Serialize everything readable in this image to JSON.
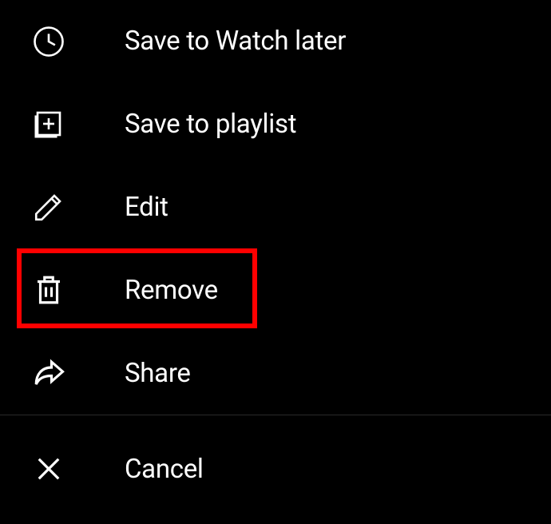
{
  "menu": {
    "items": [
      {
        "label": "Save to Watch later",
        "icon": "clock"
      },
      {
        "label": "Save to playlist",
        "icon": "playlist-add"
      },
      {
        "label": "Edit",
        "icon": "pencil"
      },
      {
        "label": "Remove",
        "icon": "trash"
      },
      {
        "label": "Share",
        "icon": "share-arrow"
      }
    ],
    "cancel_label": "Cancel"
  },
  "highlighted_item_index": 3
}
